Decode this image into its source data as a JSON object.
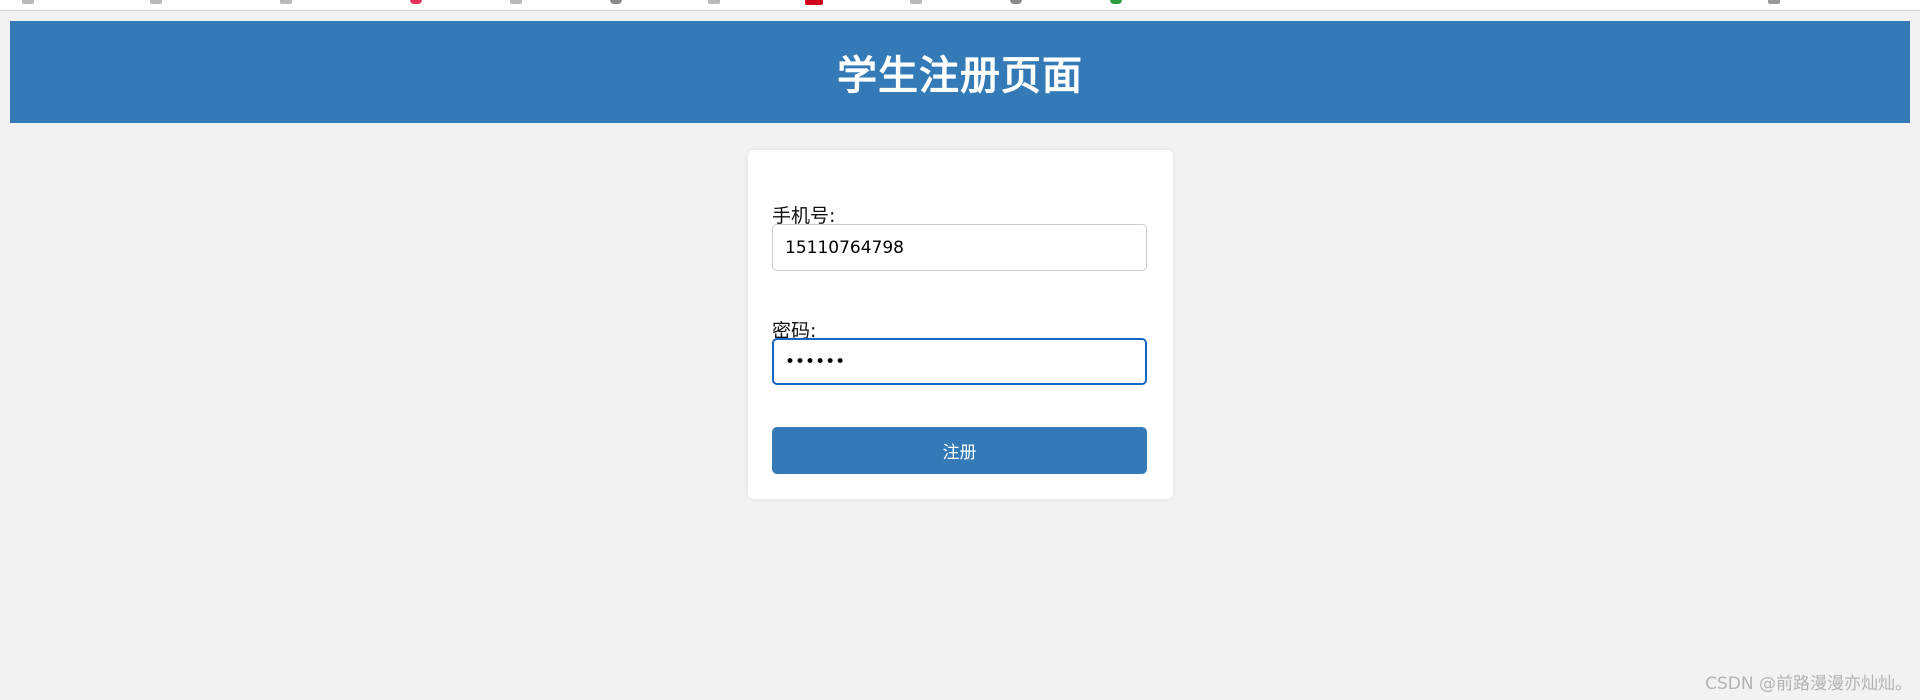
{
  "header": {
    "title": "学生注册页面"
  },
  "form": {
    "phone_label": "手机号:",
    "phone_value": "15110764798",
    "password_label": "密码:",
    "password_value": "123456",
    "submit_label": "注册"
  },
  "watermark": {
    "text": "CSDN @前路漫漫亦灿灿。"
  },
  "colors": {
    "primary": "#337ab7",
    "background": "#f2f2f2",
    "focus_border": "#1a64c6"
  }
}
